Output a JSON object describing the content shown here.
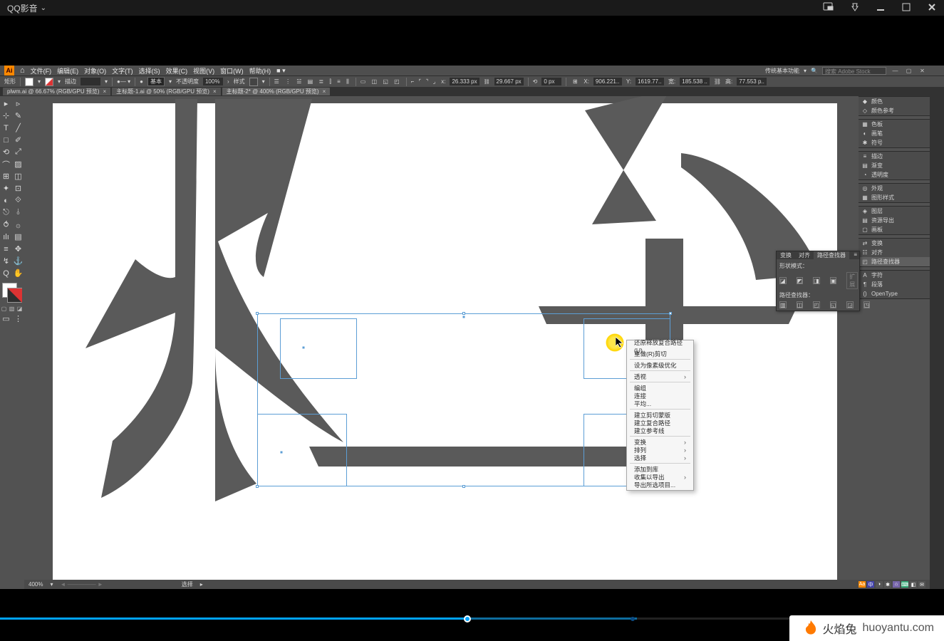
{
  "player": {
    "title": "QQ影音",
    "dropdown_glyph": "⌄"
  },
  "illustrator": {
    "logo": "Ai",
    "home_glyph": "⌂",
    "menus": [
      "文件(F)",
      "编辑(E)",
      "对象(O)",
      "文字(T)",
      "选择(S)",
      "效果(C)",
      "视图(V)",
      "窗口(W)",
      "帮助(H)",
      "■ ▾"
    ],
    "workspace": "传统基本功能",
    "search_placeholder": "搜索 Adobe Stock",
    "control": {
      "label_left": "矩形",
      "stroke_label": "描边",
      "stroke_weight": "",
      "style_label": "基本",
      "opacity_label": "不透明度",
      "opacity": "100%",
      "style2": "样式",
      "x_label": "x:",
      "xy_field1": "26.333 px",
      "xy_field2": "29.667 px",
      "ang_field": "0 px",
      "X": "X:",
      "xv": "906.221..",
      "Y": "Y:",
      "yv": "1619.77..",
      "W": "宽:",
      "wv": "185.538 ..",
      "link": "⛓",
      "H": "高:",
      "hv": "77.553 p.."
    },
    "tabs": [
      {
        "label": "plwm.ai @ 66.67% (RGB/GPU 预览)"
      },
      {
        "label": "主标题-1.ai @ 50% (RGB/GPU 预览)"
      },
      {
        "label": "主标题-2* @ 400% (RGB/GPU 预览)",
        "active": true
      }
    ],
    "toolbox": [
      [
        "▸",
        "▹"
      ],
      [
        "⊹",
        "✎"
      ],
      [
        "T",
        "╱"
      ],
      [
        "□",
        "✐"
      ],
      [
        "⟲",
        "⤢"
      ],
      [
        "⌒",
        "▨"
      ],
      [
        "⊞",
        "◫"
      ],
      [
        "✦",
        "⊡"
      ],
      [
        "◐",
        "⟐"
      ],
      [
        "⎋",
        "⫰"
      ],
      [
        "⥀",
        "۞"
      ],
      [
        "ılı",
        "▤"
      ],
      [
        "≡",
        "✥"
      ],
      [
        "↯",
        "⚓"
      ],
      [
        "Q",
        "✋"
      ]
    ],
    "tool_mini": [
      "▢",
      "▧",
      "◪"
    ],
    "panels_right": [
      {
        "group": [
          {
            "icon": "◆",
            "label": "颜色"
          },
          {
            "icon": "◇",
            "label": "颜色参考"
          }
        ]
      },
      {
        "group": [
          {
            "icon": "▦",
            "label": "色板"
          },
          {
            "icon": "◐",
            "label": "画笔"
          },
          {
            "icon": "✱",
            "label": "符号"
          }
        ]
      },
      {
        "group": [
          {
            "icon": "≡",
            "label": "描边"
          },
          {
            "icon": "▤",
            "label": "渐变"
          },
          {
            "icon": "◔",
            "label": "透明度"
          }
        ]
      },
      {
        "group": [
          {
            "icon": "◎",
            "label": "外观"
          },
          {
            "icon": "▦",
            "label": "图形样式"
          }
        ]
      },
      {
        "group": [
          {
            "icon": "◈",
            "label": "图层"
          },
          {
            "icon": "▤",
            "label": "资源导出"
          },
          {
            "icon": "▢",
            "label": "画板"
          }
        ]
      },
      {
        "group": [
          {
            "icon": "⇄",
            "label": "变换"
          },
          {
            "icon": "☷",
            "label": "对齐"
          },
          {
            "icon": "◰",
            "label": "路径查找器",
            "active": true
          }
        ]
      },
      {
        "group": [
          {
            "icon": "A",
            "label": "字符"
          },
          {
            "icon": "¶",
            "label": "段落"
          },
          {
            "icon": "()",
            "label": "OpenType"
          }
        ]
      }
    ],
    "float_panel": {
      "tabs": [
        "变换",
        "对齐",
        "路径查找器"
      ],
      "active_tab": 2,
      "label1": "形状模式：",
      "label2": "路径查找器：",
      "expand": "扩展",
      "shape_icons": [
        "◪",
        "◩",
        "◨",
        "▣"
      ],
      "path_icons": [
        "▥",
        "◫",
        "◰",
        "◱",
        "◲",
        "◳"
      ]
    },
    "context_menu": [
      {
        "label": "还原释放复合路径(U)"
      },
      {
        "label": "重做(R)剪切"
      },
      "sep",
      {
        "label": "设为像素级优化"
      },
      "sep",
      {
        "label": "透视",
        "sub": true
      },
      "sep",
      {
        "label": "编组"
      },
      {
        "label": "连接"
      },
      {
        "label": "平均..."
      },
      "sep",
      {
        "label": "建立剪切蒙版"
      },
      {
        "label": "建立复合路径"
      },
      {
        "label": "建立参考线"
      },
      "sep",
      {
        "label": "变换",
        "sub": true
      },
      {
        "label": "排列",
        "sub": true
      },
      {
        "label": "选择",
        "sub": true
      },
      "sep",
      {
        "label": "添加到库"
      },
      {
        "label": "收集以导出",
        "sub": true
      },
      {
        "label": "导出所选项目..."
      }
    ],
    "status": {
      "zoom": "400%",
      "mode_label": "选择",
      "chips": [
        "Aa",
        "中",
        "◑",
        "✱",
        "⌂",
        "⌨",
        "◧",
        "✉"
      ]
    }
  },
  "watermark": {
    "text_cn": "火焰兔",
    "text_en": "huoyantu.com"
  }
}
